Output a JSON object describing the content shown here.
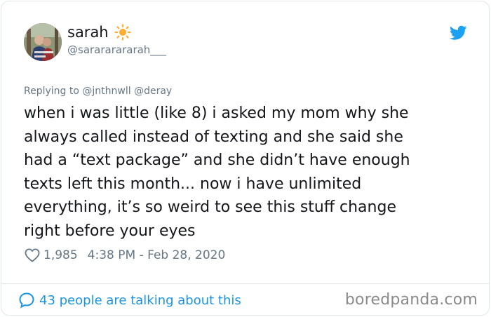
{
  "user": {
    "display_name": "sarah",
    "handle": "@sarararararah___",
    "name_emoji": "sun-icon"
  },
  "tweet": {
    "replying_prefix": "Replying to",
    "replying_mentions": "@jnthnwll @deray",
    "text": "when i was little (like 8) i asked my mom why she\nalways called instead of texting and she said she\nhad a “text package” and she didn’t have enough\ntexts left this month... now i have unlimited\neverything, it’s so weird to see this stuff change\nright before your eyes",
    "likes": "1,985",
    "timestamp": "4:38 PM - Feb 28, 2020"
  },
  "footer": {
    "talking_text": "43 people are talking about this",
    "watermark": "boredpanda.com"
  },
  "colors": {
    "twitter_blue": "#1da1f2",
    "link_blue": "#1b95e0",
    "secondary_text": "#657786",
    "sun_yellow": "#ffac33"
  }
}
